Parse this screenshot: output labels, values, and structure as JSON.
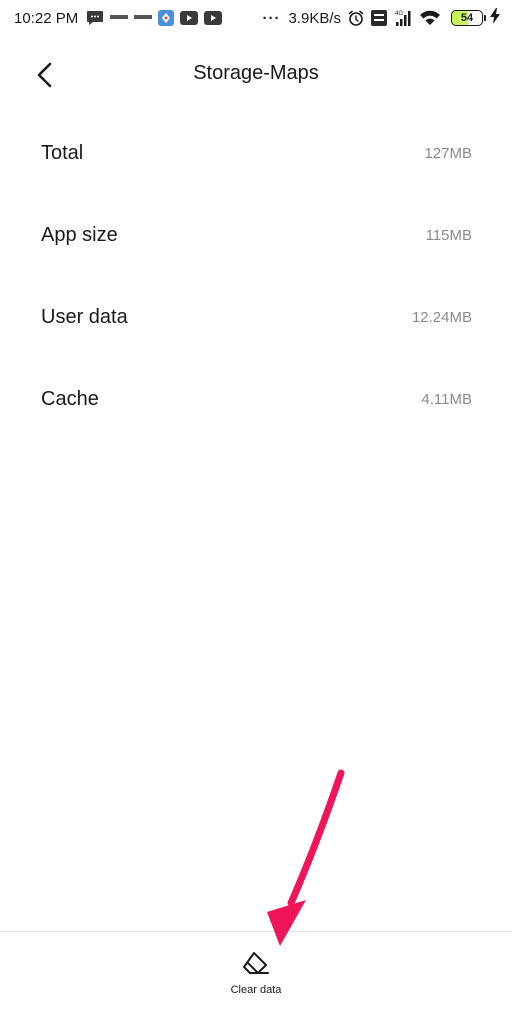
{
  "status_bar": {
    "time": "10:22 PM",
    "network_speed": "3.9KB/s",
    "more_indicator": "···",
    "signal_type": "4G",
    "battery_level": "54",
    "battery_fill_percent": 54,
    "icons": [
      "message-icon",
      "ndtv-icon",
      "ndtv-icon",
      "app-icon",
      "youtube-icon",
      "youtube-icon",
      "alarm-icon",
      "volte-icon",
      "signal-icon",
      "wifi-icon",
      "battery-icon",
      "charging-icon"
    ]
  },
  "header": {
    "title": "Storage-Maps",
    "back_icon": "chevron-left-icon"
  },
  "storage": {
    "rows": [
      {
        "label": "Total",
        "value": "127MB"
      },
      {
        "label": "App size",
        "value": "115MB"
      },
      {
        "label": "User data",
        "value": "12.24MB"
      },
      {
        "label": "Cache",
        "value": "4.11MB"
      }
    ]
  },
  "bottom_bar": {
    "clear_data_label": "Clear data",
    "clear_data_icon": "eraser-icon"
  },
  "colors": {
    "background": "#ffffff",
    "text_primary": "#1a1a1a",
    "text_secondary": "#8a8a8a",
    "battery_fill": "#c9f55a",
    "annotation_arrow": "#f0145a"
  }
}
